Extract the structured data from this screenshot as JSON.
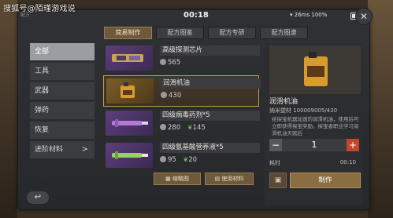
{
  "watermark": "搜狐号@陌瑾游戏说",
  "status": {
    "time": "00:18",
    "net": "26ms",
    "battery": "100%"
  },
  "corner_tag": "配方",
  "tabs": [
    {
      "label": "简易制作",
      "active": true
    },
    {
      "label": "配方图鉴",
      "active": false
    },
    {
      "label": "配方专研",
      "active": false
    },
    {
      "label": "配方图谱",
      "active": false
    }
  ],
  "sidebar": [
    {
      "label": "全部",
      "active": true
    },
    {
      "label": "工具",
      "active": false
    },
    {
      "label": "武器",
      "active": false
    },
    {
      "label": "弹药",
      "active": false
    },
    {
      "label": "恢复",
      "active": false
    },
    {
      "label": "进阶材料",
      "active": false,
      "chevron": ">"
    }
  ],
  "items": [
    {
      "name": "高级探测芯片",
      "cost1": "565",
      "cost2": "",
      "thumb": "purple",
      "icon": "chip-icon",
      "selected": false
    },
    {
      "name": "润滑机油",
      "cost1": "430",
      "cost2": "",
      "thumb": "gold",
      "icon": "oil-can-icon",
      "selected": true
    },
    {
      "name": "四级病毒药剂*5",
      "cost1": "280",
      "cost2": "145",
      "thumb": "purple",
      "icon": "syringe-icon",
      "selected": false
    },
    {
      "name": "四级氨基酸营养液*5",
      "cost1": "95",
      "cost2": "20",
      "thumb": "purple",
      "icon": "syringe-icon",
      "selected": false
    }
  ],
  "list_buttons": {
    "thumbnail": "缩略图",
    "materials": "使用材料"
  },
  "detail": {
    "name": "润滑机油",
    "nano_label": "纳米塑材",
    "nano_value": "100009005/430",
    "desc": "给探宝机器加速的润滑机油，使用后可立即获得探宝奖励。探宝者职业学习润滑机油天赋后",
    "quantity": "1",
    "time_label": "耗时",
    "time_value": "00:10",
    "make_label": "制作"
  },
  "back_label": "↩"
}
